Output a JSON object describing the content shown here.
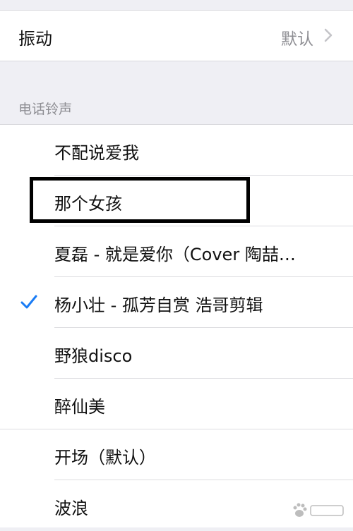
{
  "vibration": {
    "label": "振动",
    "value": "默认"
  },
  "ringtones": {
    "section_title": "电话铃声",
    "items": [
      {
        "label": "不配说爱我",
        "selected": false
      },
      {
        "label": "那个女孩",
        "selected": false,
        "highlighted": true
      },
      {
        "label": "夏磊 - 就是爱你（Cover 陶喆…",
        "selected": false
      },
      {
        "label": "杨小壮 - 孤芳自赏 浩哥剪辑",
        "selected": true
      },
      {
        "label": "野狼disco",
        "selected": false
      },
      {
        "label": "醉仙美",
        "selected": false
      }
    ],
    "builtin_items": [
      {
        "label": "开场（默认）"
      },
      {
        "label": "波浪"
      }
    ]
  },
  "colors": {
    "check": "#1a7cf5",
    "secondary_text": "#8e8e93"
  },
  "icons": {
    "disclosure": "chevron-right-icon",
    "selected": "checkmark-icon",
    "watermark": "baidu-paw-icon"
  }
}
